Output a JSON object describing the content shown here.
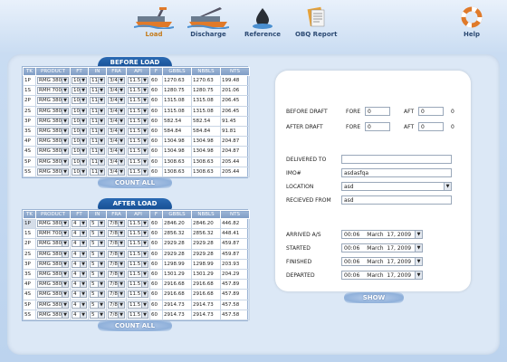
{
  "nav": [
    {
      "label": "Load",
      "icon": "ship-load-icon"
    },
    {
      "label": "Discharge",
      "icon": "ship-discharge-icon"
    },
    {
      "label": "Reference",
      "icon": "oil-drop-icon"
    },
    {
      "label": "OBQ Report",
      "icon": "report-icon"
    },
    {
      "label": "Help",
      "icon": "lifebuoy-icon"
    }
  ],
  "columns": [
    "TK",
    "PRODUCT",
    "FT",
    "IN",
    "FRA",
    "API",
    "F",
    "GBBLS",
    "NBBLS",
    "NTS"
  ],
  "before_load": {
    "title": "BEFORE LOAD",
    "button": "COUNT ALL",
    "rows": [
      [
        "1P",
        "RMG 380",
        "10",
        "11",
        "3/4",
        "11.5",
        "60",
        "1270.63",
        "1270.63",
        "199.48"
      ],
      [
        "1S",
        "RMH 700",
        "10",
        "11",
        "3/4",
        "11.5",
        "60",
        "1280.75",
        "1280.75",
        "201.06"
      ],
      [
        "2P",
        "RMG 380",
        "10",
        "11",
        "3/4",
        "11.5",
        "60",
        "1315.08",
        "1315.08",
        "206.45"
      ],
      [
        "2S",
        "RMG 380",
        "10",
        "11",
        "3/4",
        "11.5",
        "60",
        "1315.08",
        "1315.08",
        "206.45"
      ],
      [
        "3P",
        "RMG 380",
        "10",
        "11",
        "3/4",
        "11.5",
        "60",
        "582.54",
        "582.54",
        "91.45"
      ],
      [
        "3S",
        "RMG 380",
        "10",
        "11",
        "3/4",
        "11.5",
        "60",
        "584.84",
        "584.84",
        "91.81"
      ],
      [
        "4P",
        "RMG 380",
        "10",
        "11",
        "3/4",
        "11.5",
        "60",
        "1304.98",
        "1304.98",
        "204.87"
      ],
      [
        "4S",
        "RMG 380",
        "10",
        "11",
        "3/4",
        "11.5",
        "60",
        "1304.98",
        "1304.98",
        "204.87"
      ],
      [
        "5P",
        "RMG 380",
        "10",
        "11",
        "3/4",
        "11.5",
        "60",
        "1308.63",
        "1308.63",
        "205.44"
      ],
      [
        "5S",
        "RMG 380",
        "10",
        "11",
        "3/4",
        "11.5",
        "60",
        "1308.63",
        "1308.63",
        "205.44"
      ]
    ]
  },
  "after_load": {
    "title": "AFTER LOAD",
    "button": "COUNT ALL",
    "rows": [
      [
        "1P",
        "RMG 380",
        "4",
        "5",
        "7/8",
        "11.5",
        "60",
        "2846.20",
        "2846.20",
        "446.82"
      ],
      [
        "1S",
        "RMH 700",
        "4",
        "5",
        "7/8",
        "11.5",
        "60",
        "2856.32",
        "2856.32",
        "448.41"
      ],
      [
        "2P",
        "RMG 380",
        "4",
        "5",
        "7/8",
        "11.5",
        "60",
        "2929.28",
        "2929.28",
        "459.87"
      ],
      [
        "2S",
        "RMG 380",
        "4",
        "5",
        "7/8",
        "11.5",
        "60",
        "2929.28",
        "2929.28",
        "459.87"
      ],
      [
        "3P",
        "RMG 380",
        "4",
        "5",
        "7/8",
        "11.5",
        "60",
        "1298.99",
        "1298.99",
        "203.93"
      ],
      [
        "3S",
        "RMG 380",
        "4",
        "5",
        "7/8",
        "11.5",
        "60",
        "1301.29",
        "1301.29",
        "204.29"
      ],
      [
        "4P",
        "RMG 380",
        "4",
        "5",
        "7/8",
        "11.5",
        "60",
        "2916.68",
        "2916.68",
        "457.89"
      ],
      [
        "4S",
        "RMG 380",
        "4",
        "5",
        "7/8",
        "11.5",
        "60",
        "2916.68",
        "2916.68",
        "457.89"
      ],
      [
        "5P",
        "RMG 380",
        "4",
        "5",
        "7/8",
        "11.5",
        "60",
        "2914.73",
        "2914.73",
        "457.58"
      ],
      [
        "5S",
        "RMG 380",
        "4",
        "5",
        "7/8",
        "11.5",
        "60",
        "2914.73",
        "2914.73",
        "457.58"
      ]
    ]
  },
  "draft": {
    "before_label": "BEFORE DRAFT",
    "after_label": "AFTER DRAFT",
    "fore_label": "FORE",
    "aft_label": "AFT",
    "before_fore": "0",
    "before_aft": "0",
    "before_aft_result": "0",
    "after_fore": "0",
    "after_aft": "0",
    "after_aft_result": "0"
  },
  "info": {
    "delivered_to_label": "DELIVERED TO",
    "delivered_to": "",
    "imo_label": "IMO#",
    "imo": "asdasfqa",
    "location_label": "LOCATION",
    "location": "asd",
    "received_from_label": "RECIEVED FROM",
    "received_from": "asd"
  },
  "times": [
    {
      "label": "ARRIVED A/S",
      "time": "00:06",
      "date": "March  17, 2009"
    },
    {
      "label": "STARTED",
      "time": "00:06",
      "date": "March  17, 2009"
    },
    {
      "label": "FINISHED",
      "time": "00:06",
      "date": "March  17, 2009"
    },
    {
      "label": "DEPARTED",
      "time": "00:06",
      "date": "March  17, 2009"
    }
  ],
  "show_button": "SHOW"
}
